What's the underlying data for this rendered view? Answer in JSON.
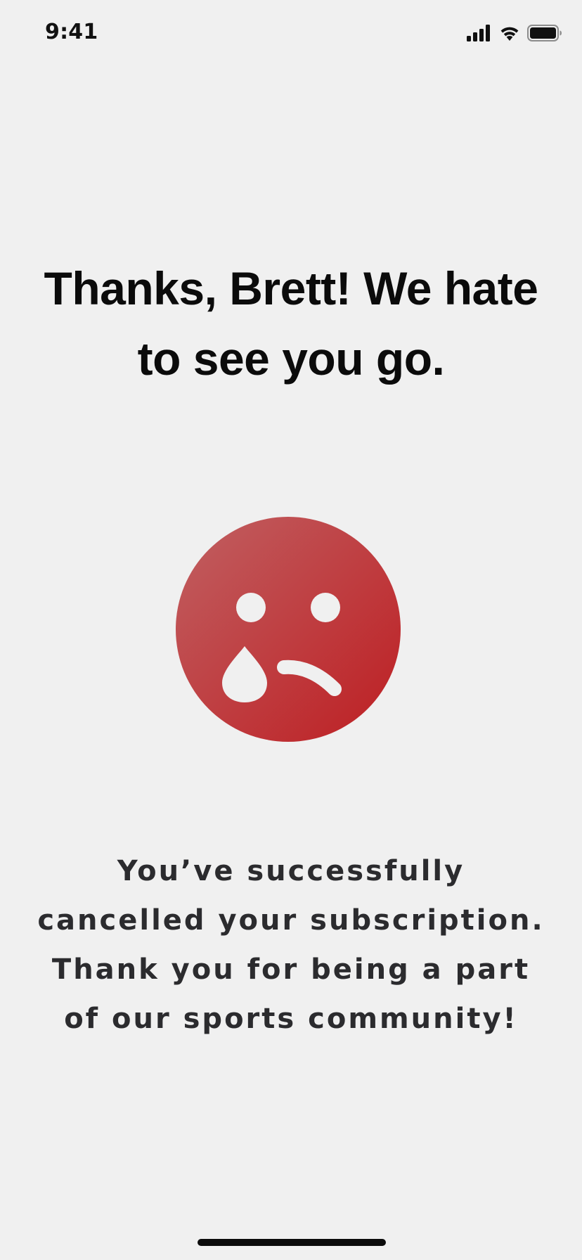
{
  "status_bar": {
    "time": "9:41",
    "icons": [
      "cellular-signal-icon",
      "wifi-icon",
      "battery-icon"
    ]
  },
  "headline": "Thanks, Brett! We hate to see you go.",
  "illustration": {
    "icon": "crying-face-icon",
    "gradient_start": "#c06062",
    "gradient_end": "#be1e22",
    "feature_color": "#f0f0f0"
  },
  "message": "You’ve successfully cancelled your subscription. Thank you for being a part of our sports community!",
  "colors": {
    "background": "#f0f0f0",
    "headline_text": "#0b0b0b",
    "body_text": "#2b2b2e"
  }
}
